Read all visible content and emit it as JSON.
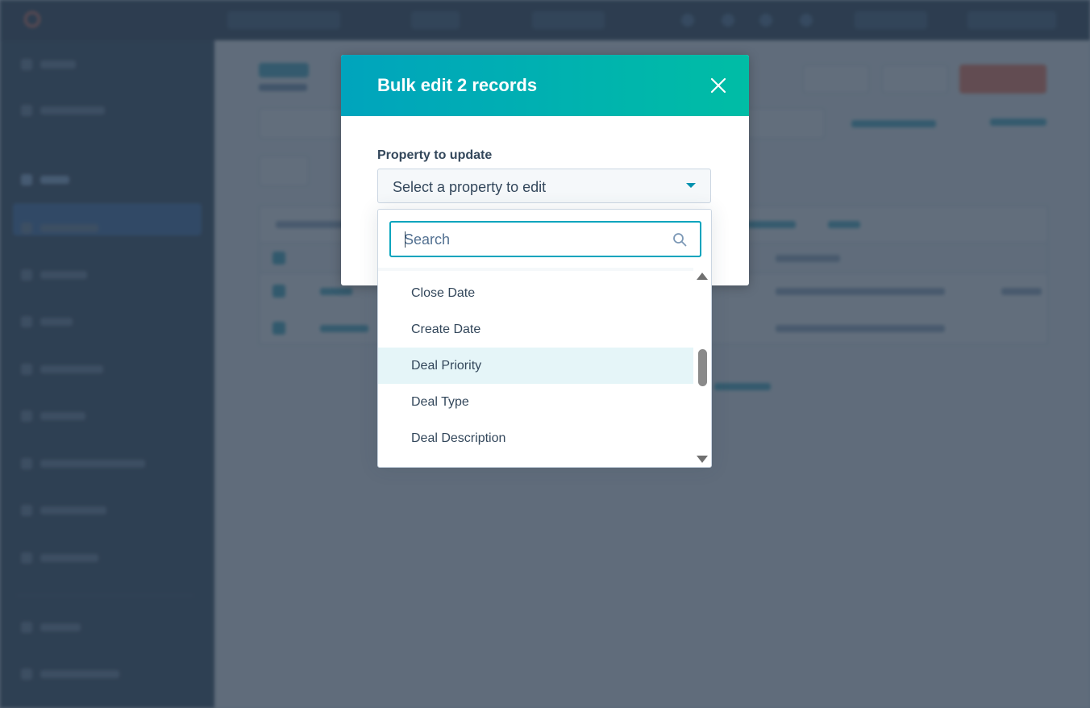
{
  "modal": {
    "title": "Bulk edit 2 records",
    "close_icon": "close-icon",
    "property_label": "Property to update",
    "select": {
      "value": "Select a property to edit",
      "icon": "caret-down-icon"
    }
  },
  "dropdown": {
    "search": {
      "placeholder": "Search",
      "value": "",
      "icon": "search-icon"
    },
    "items": [
      {
        "label": "Close Date"
      },
      {
        "label": "Create Date"
      },
      {
        "label": "Deal Priority",
        "highlighted": true
      },
      {
        "label": "Deal Type"
      },
      {
        "label": "Deal Description"
      }
    ],
    "scrollbar_icons": [
      "scroll-up-arrow-icon",
      "scroll-down-arrow-icon"
    ]
  },
  "colors": {
    "header_gradient_start": "#00a4bd",
    "header_gradient_end": "#00bda5",
    "text_dark": "#33475b",
    "focus_border": "#00a4bd",
    "highlight_row": "#e5f5f8",
    "overlay": "#2d3e50"
  }
}
